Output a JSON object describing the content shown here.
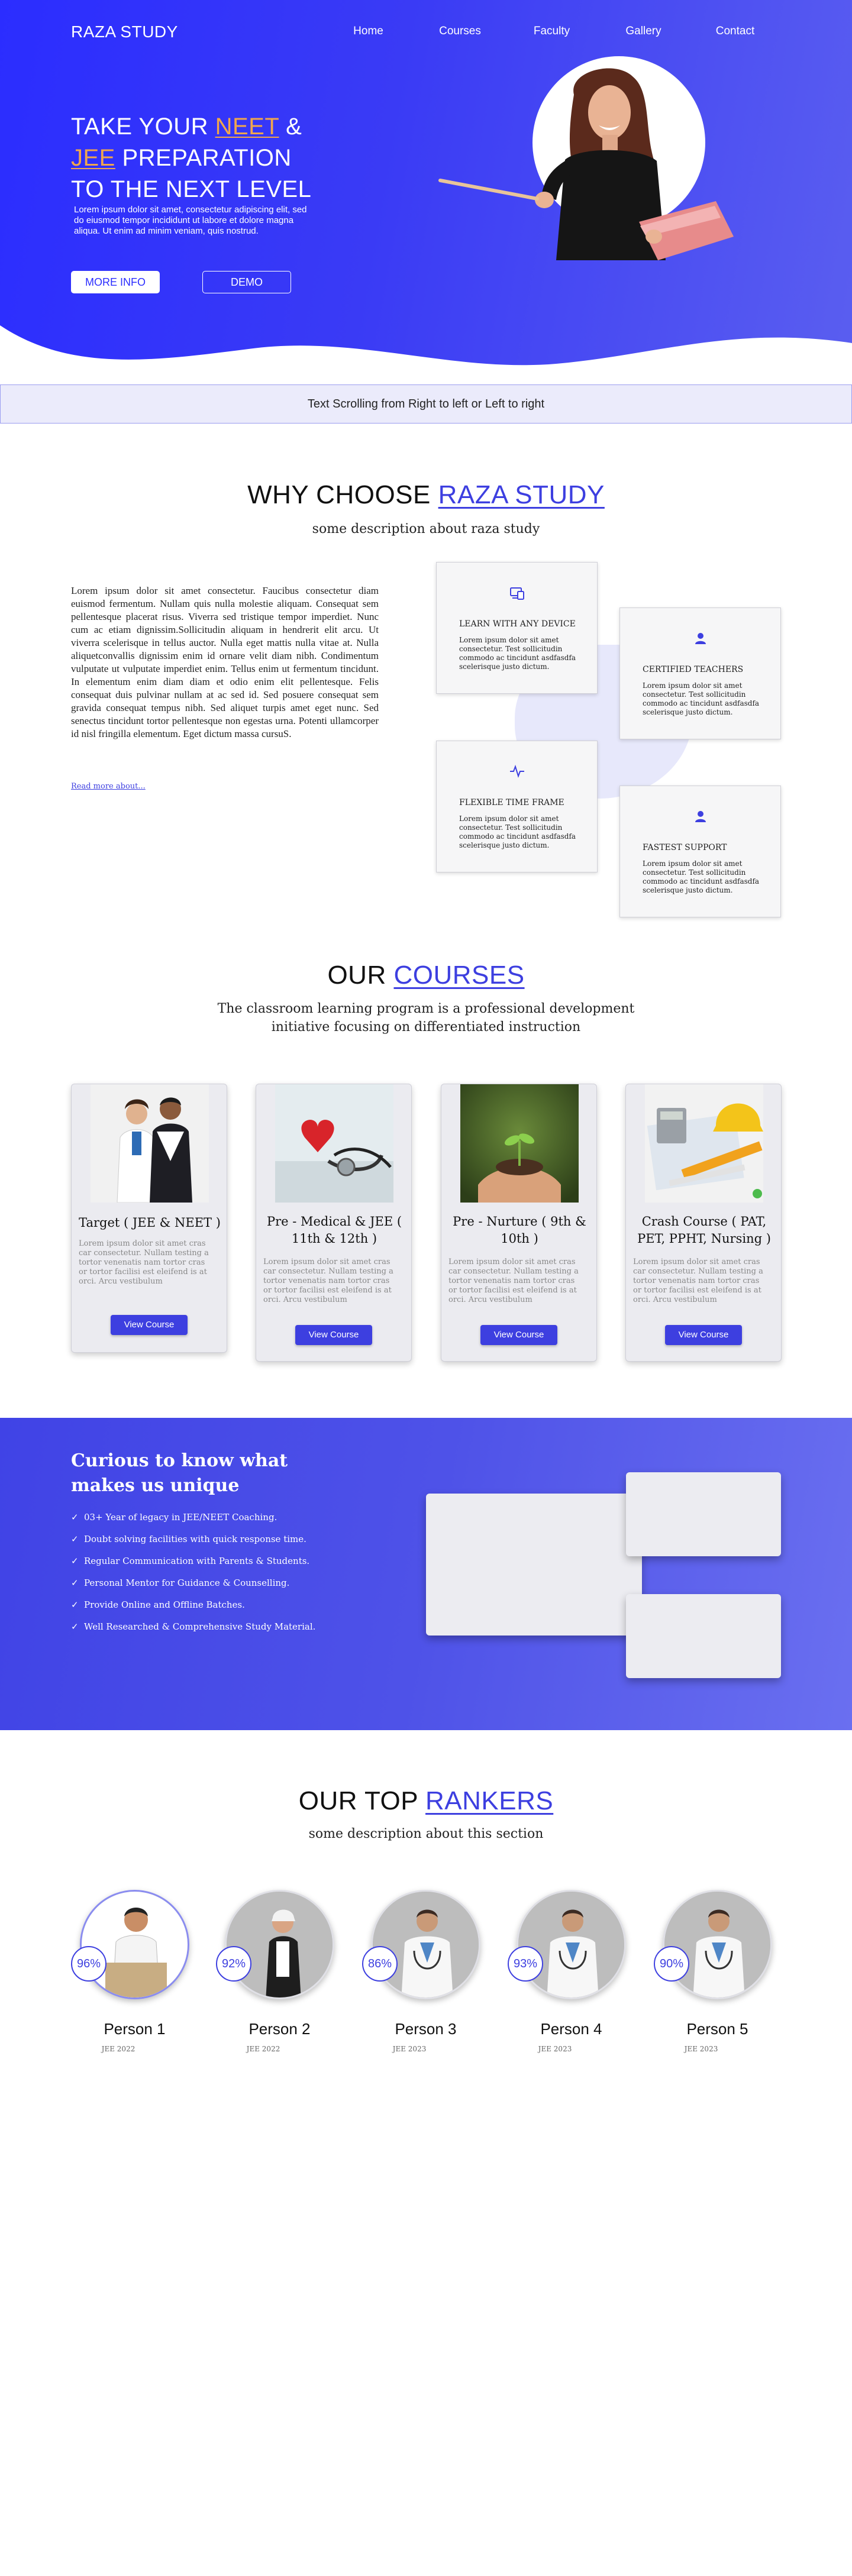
{
  "header": {
    "brand": "RAZA STUDY",
    "nav": [
      "Home",
      "Courses",
      "Faculty",
      "Gallery",
      "Contact"
    ]
  },
  "hero": {
    "title_part1": "TAKE YOUR ",
    "title_neet": "NEET",
    "title_amp": " &",
    "title_jee": "JEE",
    "title_part2": " PREPARATION",
    "title_line3": "TO THE NEXT LEVEL",
    "description": "Lorem ipsum dolor sit amet, consectetur adipiscing elit, sed do eiusmod tempor incididunt ut labore et dolore magna aliqua. Ut enim ad minim veniam, quis nostrud.",
    "btn_more": "MORE INFO",
    "btn_demo": "DEMO",
    "accent_color": "#f0a64d",
    "bg_color": "#2b2dff"
  },
  "ticker": {
    "text": "Text Scrolling from Right to left or Left to right"
  },
  "why": {
    "title_prefix": "WHY CHOOSE ",
    "title_highlight": "RAZA STUDY",
    "subtitle": "some description about raza study",
    "body": "Lorem ipsum dolor sit amet consectetur. Faucibus consectetur diam euismod fermentum. Nullam quis nulla molestie aliquam. Consequat sem pellentesque placerat risus. Viverra sed tristique tempor imperdiet. Nunc cum ac etiam dignissim.Sollicitudin aliquam in hendrerit elit arcu. Ut viverra scelerisque in tellus auctor. Nulla eget mattis nulla vitae at. Nulla aliquetconvallis dignissim enim id ornare velit diam nibh. Condimentum vulputate ut vulputate imperdiet enim. Tellus enim ut fermentum tincidunt. In elementum enim diam diam et odio enim elit pellentesque. Felis consequat duis pulvinar nullam at ac sed id. Sed posuere consequat sem gravida consequat tempus nibh. Sed aliquet turpis amet eget nunc. Sed senectus tincidunt tortor pellentesque non egestas urna. Potenti ullamcorper id nisl fringilla elementum. Eget dictum massa cursuS.",
    "read_more": "Read more about...",
    "features": [
      {
        "icon": "devices-icon",
        "title": "LEARN WITH ANY DEVICE",
        "desc": "Lorem ipsum dolor sit amet consectetur. Test sollicitudin commodo ac tincidunt asdfasdfa scelerisque justo dictum."
      },
      {
        "icon": "person-icon",
        "title": "CERTIFIED TEACHERS",
        "desc": "Lorem ipsum dolor sit amet consectetur. Test sollicitudin commodo ac tincidunt asdfasdfa scelerisque justo dictum."
      },
      {
        "icon": "pulse-icon",
        "title": "FLEXIBLE TIME FRAME",
        "desc": "Lorem ipsum dolor sit amet consectetur. Test sollicitudin commodo ac tincidunt asdfasdfa scelerisque justo dictum."
      },
      {
        "icon": "person-icon",
        "title": "FASTEST SUPPORT",
        "desc": "Lorem ipsum dolor sit amet consectetur. Test sollicitudin commodo ac tincidunt asdfasdfa scelerisque justo dictum."
      }
    ]
  },
  "courses": {
    "title_prefix": "OUR ",
    "title_highlight": "COURSES",
    "subtitle": "The classroom learning program is a professional development initiative focusing on differentiated instruction",
    "items": [
      {
        "title": "Target ( JEE & NEET )",
        "desc": "Lorem ipsum dolor sit amet cras car consectetur. Nullam testing a tortor venenatis nam tortor cras or tortor facilisi est eleifend is at orci. Arcu vestibulum",
        "button": "View Course",
        "image": "doctors-photo"
      },
      {
        "title": "Pre - Medical & JEE ( 11th & 12th )",
        "desc": "Lorem ipsum dolor sit amet cras car consectetur. Nullam testing a tortor venenatis nam tortor cras or tortor facilisi est eleifend is at orci. Arcu vestibulum",
        "button": "View Course",
        "image": "stethoscope-heart-photo"
      },
      {
        "title": "Pre - Nurture ( 9th & 10th )",
        "desc": "Lorem ipsum dolor sit amet cras car consectetur. Nullam testing a tortor venenatis nam tortor cras or tortor facilisi est eleifend is at orci. Arcu vestibulum",
        "button": "View Course",
        "image": "seedling-hands-photo"
      },
      {
        "title": "Crash Course ( PAT, PET, PPHT, Nursing )",
        "desc": "Lorem ipsum dolor sit amet cras car consectetur. Nullam testing a tortor venenatis nam tortor cras or tortor facilisi est eleifend is at orci. Arcu vestibulum",
        "button": "View Course",
        "image": "engineering-tools-photo"
      }
    ]
  },
  "unique": {
    "title": "Curious to know what makes us unique",
    "points": [
      "03+ Year of legacy in JEE/NEET Coaching.",
      "Doubt solving facilities with quick response time.",
      "Regular Communication with Parents & Students.",
      "Personal Mentor for Guidance & Counselling.",
      "Provide Online and Offline Batches.",
      "Well Researched & Comprehensive Study Material."
    ]
  },
  "rankers": {
    "title_prefix": "OUR TOP ",
    "title_highlight": "RANKERS",
    "subtitle": "some description about this section",
    "items": [
      {
        "name": "Person 1",
        "year": "JEE 2022",
        "percent": "96%"
      },
      {
        "name": "Person 2",
        "year": "JEE 2022",
        "percent": "92%"
      },
      {
        "name": "Person 3",
        "year": "JEE 2023",
        "percent": "86%"
      },
      {
        "name": "Person 4",
        "year": "JEE 2023",
        "percent": "93%"
      },
      {
        "name": "Person 5",
        "year": "JEE 2023",
        "percent": "90%"
      }
    ]
  },
  "colors": {
    "primary": "#3d3fe0",
    "accent": "#f0a64d"
  }
}
